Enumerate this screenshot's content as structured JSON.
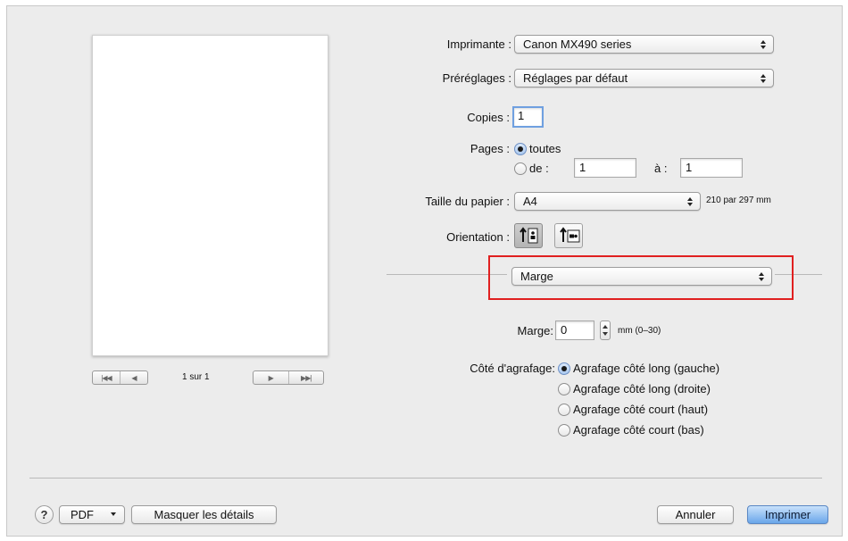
{
  "printer": {
    "label": "Imprimante :",
    "value": "Canon MX490 series"
  },
  "presets": {
    "label": "Préréglages :",
    "value": "Réglages par défaut"
  },
  "copies": {
    "label": "Copies :",
    "value": "1"
  },
  "pages": {
    "label": "Pages :",
    "all_label": "toutes",
    "from_label": "de :",
    "from_value": "1",
    "to_label": "à :",
    "to_value": "1"
  },
  "paper_size": {
    "label": "Taille du papier :",
    "value": "A4",
    "dimensions": "210 par 297 mm"
  },
  "orientation": {
    "label": "Orientation :"
  },
  "section_popup": {
    "value": "Marge"
  },
  "margin": {
    "label": "Marge:",
    "value": "0",
    "unit": "mm (0–30)"
  },
  "stapling": {
    "label": "Côté d'agrafage:",
    "options": [
      "Agrafage côté long (gauche)",
      "Agrafage côté long (droite)",
      "Agrafage côté court (haut)",
      "Agrafage côté court (bas)"
    ],
    "selected_index": 0
  },
  "preview": {
    "page_indicator": "1 sur 1"
  },
  "footer": {
    "help": "?",
    "pdf": "PDF",
    "hide_details": "Masquer les détails",
    "cancel": "Annuler",
    "print": "Imprimer"
  },
  "colors": {
    "highlight": "#e02020",
    "default_button": "#6aa6ea"
  }
}
